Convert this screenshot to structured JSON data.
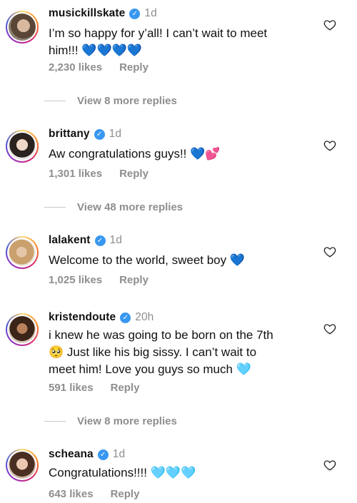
{
  "comments": [
    {
      "username": "musickillskate",
      "verified": true,
      "time": "1d",
      "line1": "I’m so happy for y’all! I can’t wait to meet",
      "line2": "him!!! ",
      "emoji": "💙💙💙💙",
      "likes": "2,230 likes",
      "reply": "Reply",
      "view_more": "View 8 more replies"
    },
    {
      "username": "brittany",
      "verified": true,
      "time": "1d",
      "line1": "Aw congratulations guys!! ",
      "emoji": "💙💕",
      "likes": "1,301 likes",
      "reply": "Reply",
      "view_more": "View 48 more replies"
    },
    {
      "username": "lalakent",
      "verified": true,
      "time": "1d",
      "line1": "Welcome to the world, sweet boy ",
      "emoji": "💙",
      "likes": "1,025 likes",
      "reply": "Reply"
    },
    {
      "username": "kristendoute",
      "verified": true,
      "time": "20h",
      "line1": "i knew he was going to be born on the 7th",
      "line2": "🥺 Just like his big sissy. I can’t wait to",
      "line3": "meet him! Love you guys so much ",
      "emoji": "🩵",
      "likes": "591 likes",
      "reply": "Reply",
      "view_more": "View 8 more replies"
    },
    {
      "username": "scheana",
      "verified": true,
      "time": "1d",
      "line1": "Congratulations!!!! ",
      "emoji": "🩵🩵🩵",
      "likes": "643 likes",
      "reply": "Reply"
    }
  ],
  "icons": {
    "verified": "verified-badge-icon",
    "like": "heart-outline-icon"
  },
  "colors": {
    "meta_text": "#8e8e8e",
    "verified": "#3897f0"
  }
}
